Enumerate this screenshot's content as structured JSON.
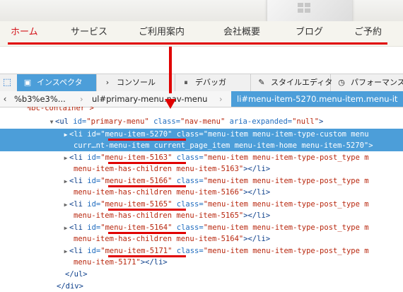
{
  "site": {
    "nav": [
      {
        "label": "ホーム",
        "active": true
      },
      {
        "label": "サービス",
        "active": false
      },
      {
        "label": "ご利用案内",
        "active": false
      },
      {
        "label": "会社概要",
        "active": false
      },
      {
        "label": "ブログ",
        "active": false
      },
      {
        "label": "ご予約",
        "active": false
      }
    ]
  },
  "devtools": {
    "tabs": [
      {
        "label": "インスペクタ",
        "icon": "inspector-icon",
        "selected": true
      },
      {
        "label": "コンソール",
        "icon": "console-icon",
        "selected": false
      },
      {
        "label": "デバッガ",
        "icon": "debugger-icon",
        "selected": false
      },
      {
        "label": "スタイルエディタ",
        "icon": "style-editor-icon",
        "selected": false
      },
      {
        "label": "パフォーマンス",
        "icon": "performance-icon",
        "selected": false
      }
    ],
    "breadcrumbs": [
      {
        "label": "%b3%e3%..."
      },
      {
        "label": "ul#primary-menu.nav-menu"
      },
      {
        "label": "li#menu-item-5270.menu-item.menu-it"
      }
    ]
  },
  "code": {
    "container_line": "%bc-container\">",
    "ul_open": {
      "tag": "<ul",
      "id_attr": " id=",
      "id_val": "\"primary-menu\"",
      "class_attr": " class=",
      "class_val": "\"nav-menu\"",
      "aria_attr": " aria-expanded=",
      "aria_val": "\"null\"",
      "close": ">"
    },
    "items": [
      {
        "id": "\"menu-item-5270\"",
        "class_part1": "\"menu-item menu-item-type-custom menu",
        "class_part2": "curr…nt-menu-item current_page_item menu-item-home menu-item-5270\"",
        "close": ">",
        "selected": true
      },
      {
        "id": "\"menu-item-5163\"",
        "class_part1": "\"menu-item menu-item-type-post_type m",
        "class_part2": "menu-item-has-children menu-item-5163\"",
        "close": "></li>",
        "selected": false
      },
      {
        "id": "\"menu-item-5166\"",
        "class_part1": "\"menu-item menu-item-type-post_type m",
        "class_part2": "menu-item-has-children menu-item-5166\"",
        "close": "></li>",
        "selected": false
      },
      {
        "id": "\"menu-item-5165\"",
        "class_part1": "\"menu-item menu-item-type-post_type m",
        "class_part2": "menu-item-has-children menu-item-5165\"",
        "close": "></li>",
        "selected": false
      },
      {
        "id": "\"menu-item-5164\"",
        "class_part1": "\"menu-item menu-item-type-post_type m",
        "class_part2": "menu-item-has-children menu-item-5164\"",
        "close": "></li>",
        "selected": false
      },
      {
        "id": "\"menu-item-5171\"",
        "class_part1": "\"menu-item menu-item-type-post_type m",
        "class_part2": "menu-item-5171\"",
        "close": "></li>",
        "selected": false
      }
    ],
    "li_tag": "<li",
    "id_attr": " id=",
    "class_attr": " class=",
    "ul_close": "</ul>",
    "div_close": "</div>"
  },
  "colors": {
    "accent": "#e00000",
    "selection": "#4c9ed9",
    "brand_red": "#d4141b"
  }
}
